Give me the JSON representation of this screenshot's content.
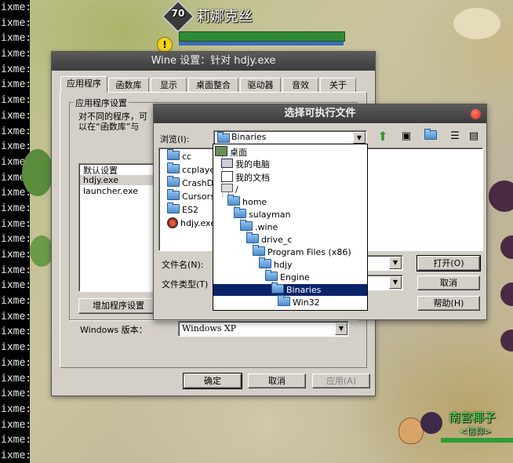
{
  "terminal": {
    "lines": [
      "ixme:",
      "ixme:",
      "ixme:",
      "ixme:",
      "ixme:",
      "ixme:",
      "ixme:",
      "ixme:",
      "ixme:",
      "ixme:",
      "ixme:",
      "ixme:",
      "ixme:",
      "ixme:",
      "ixme:",
      "ixme:",
      "ixme:",
      "ixme:",
      "ixme:",
      "ixme:",
      "ixme:",
      "ixme:",
      "ixme:",
      "ixme:",
      "ixme:",
      "ixme:",
      "ixme:",
      "ixme:",
      "ixme:",
      "ixme:"
    ]
  },
  "game": {
    "top_player": {
      "level": "70",
      "name": "莉娜克丝"
    },
    "alert_icon": "!",
    "bottom_player": {
      "name": "南宫椰子",
      "tag": "<信仰>"
    }
  },
  "wine": {
    "title": "Wine 设置：针对 hdjy.exe",
    "tabs": [
      "应用程序",
      "函数库",
      "显示",
      "桌面整合",
      "驱动器",
      "音效",
      "关于"
    ],
    "group_label": "应用程序设置",
    "description_line1": "对不同的程序，可",
    "description_line2": "以在“函数库”与",
    "app_list": [
      "默认设置",
      "hdjy.exe",
      "launcher.exe"
    ],
    "add_app_button": "增加程序设置",
    "windows_version_label": "Windows 版本：",
    "windows_version_value": "Windows XP",
    "ok_button": "确定",
    "cancel_button": "取消",
    "apply_button": "应用(A)"
  },
  "select": {
    "title": "选择可执行文件",
    "browse_label": "浏览(I):",
    "browse_value": "Binaries",
    "files": [
      "cc",
      "ccplayer",
      "CrashDum",
      "Cursors",
      "ES2",
      "hdjy.exe"
    ],
    "filename_label": "文件名(N):",
    "filetype_label": "文件类型(T)",
    "open_button": "打开(O)",
    "cancel_button": "取消",
    "help_button": "帮助(H)",
    "tree": [
      {
        "label": "桌面",
        "icon": "desktop-icon"
      },
      {
        "label": "我的电脑",
        "icon": "computer-icon"
      },
      {
        "label": "我的文档",
        "icon": "documents-icon"
      },
      {
        "label": "/",
        "icon": "drive-icon"
      },
      {
        "label": "home",
        "icon": "folder-icon"
      },
      {
        "label": "sulayman",
        "icon": "folder-icon"
      },
      {
        "label": ".wine",
        "icon": "folder-icon"
      },
      {
        "label": "drive_c",
        "icon": "folder-icon"
      },
      {
        "label": "Program Files (x86)",
        "icon": "folder-icon"
      },
      {
        "label": "hdjy",
        "icon": "folder-icon"
      },
      {
        "label": "Engine",
        "icon": "folder-icon"
      },
      {
        "label": "Binaries",
        "icon": "folder-icon",
        "selected": true
      },
      {
        "label": "Win32",
        "icon": "folder-icon"
      }
    ]
  }
}
